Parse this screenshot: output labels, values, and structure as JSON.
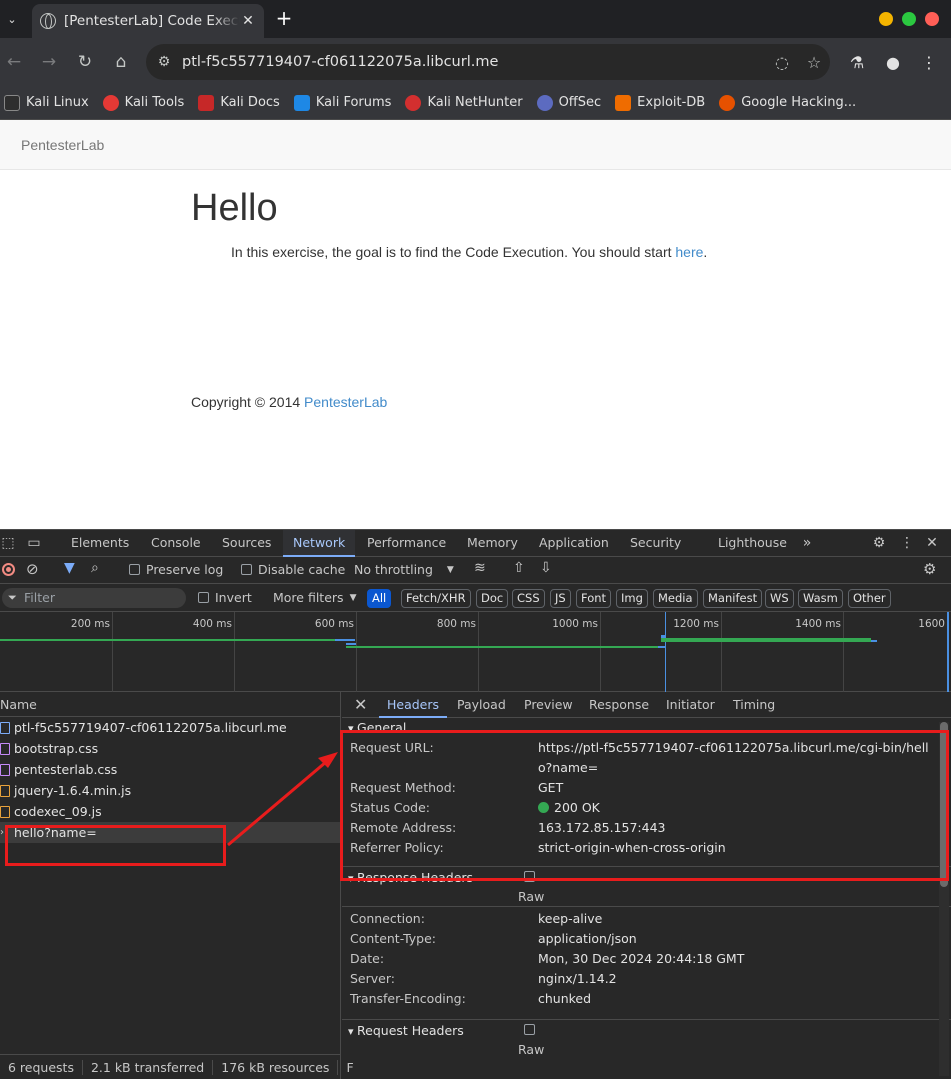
{
  "browser": {
    "tab_title": "[PentesterLab] Code Execution",
    "url": "ptl-f5c557719407-cf061122075a.libcurl.me",
    "bookmarks": [
      "Kali Linux",
      "Kali Tools",
      "Kali Docs",
      "Kali Forums",
      "Kali NetHunter",
      "OffSec",
      "Exploit-DB",
      "Google Hacking..."
    ],
    "traffic_colors": [
      "#f4b400",
      "#2bc840",
      "#ff5f57"
    ]
  },
  "page": {
    "brand": "PentesterLab",
    "heading": "Hello",
    "intro_text": "In this exercise, the goal is to find the Code Execution. You should start ",
    "intro_link": "here",
    "intro_end": ".",
    "copyright": "Copyright © 2014 ",
    "copyright_link": "PentesterLab"
  },
  "devtools": {
    "tabs": [
      "Elements",
      "Console",
      "Sources",
      "Network",
      "Performance",
      "Memory",
      "Application",
      "Security",
      "Lighthouse"
    ],
    "active_tab": "Network",
    "preserve_log": "Preserve log",
    "disable_cache": "Disable cache",
    "throttling": "No throttling",
    "filter_placeholder": "Filter",
    "invert": "Invert",
    "more_filters": "More filters",
    "type_filters": [
      "All",
      "Fetch/XHR",
      "Doc",
      "CSS",
      "JS",
      "Font",
      "Img",
      "Media",
      "Manifest",
      "WS",
      "Wasm",
      "Other"
    ],
    "timeline_ticks": [
      "200 ms",
      "400 ms",
      "600 ms",
      "800 ms",
      "1000 ms",
      "1200 ms",
      "1400 ms",
      "1600"
    ],
    "name_header": "Name",
    "requests": [
      {
        "name": "ptl-f5c557719407-cf061122075a.libcurl.me",
        "type": "doc"
      },
      {
        "name": "bootstrap.css",
        "type": "css"
      },
      {
        "name": "pentesterlab.css",
        "type": "css"
      },
      {
        "name": "jquery-1.6.4.min.js",
        "type": "js"
      },
      {
        "name": "codexec_09.js",
        "type": "js"
      },
      {
        "name": "hello?name=",
        "type": "xhr"
      }
    ],
    "status": {
      "requests": "6 requests",
      "transferred": "2.1 kB transferred",
      "resources": "176 kB resources",
      "more": "F"
    },
    "detail_tabs": [
      "Headers",
      "Payload",
      "Preview",
      "Response",
      "Initiator",
      "Timing"
    ],
    "general": {
      "title": "General",
      "rows": [
        {
          "k": "Request URL:",
          "v": "https://ptl-f5c557719407-cf061122075a.libcurl.me/cgi-bin/hello?name="
        },
        {
          "k": "Request Method:",
          "v": "GET"
        },
        {
          "k": "Status Code:",
          "v": "200 OK"
        },
        {
          "k": "Remote Address:",
          "v": "163.172.85.157:443"
        },
        {
          "k": "Referrer Policy:",
          "v": "strict-origin-when-cross-origin"
        }
      ]
    },
    "response_headers": {
      "title": "Response Headers",
      "raw": "Raw",
      "rows": [
        {
          "k": "Connection:",
          "v": "keep-alive"
        },
        {
          "k": "Content-Type:",
          "v": "application/json"
        },
        {
          "k": "Date:",
          "v": "Mon, 30 Dec 2024 20:44:18 GMT"
        },
        {
          "k": "Server:",
          "v": "nginx/1.14.2"
        },
        {
          "k": "Transfer-Encoding:",
          "v": "chunked"
        }
      ]
    },
    "request_headers": {
      "title": "Request Headers",
      "raw": "Raw"
    }
  }
}
